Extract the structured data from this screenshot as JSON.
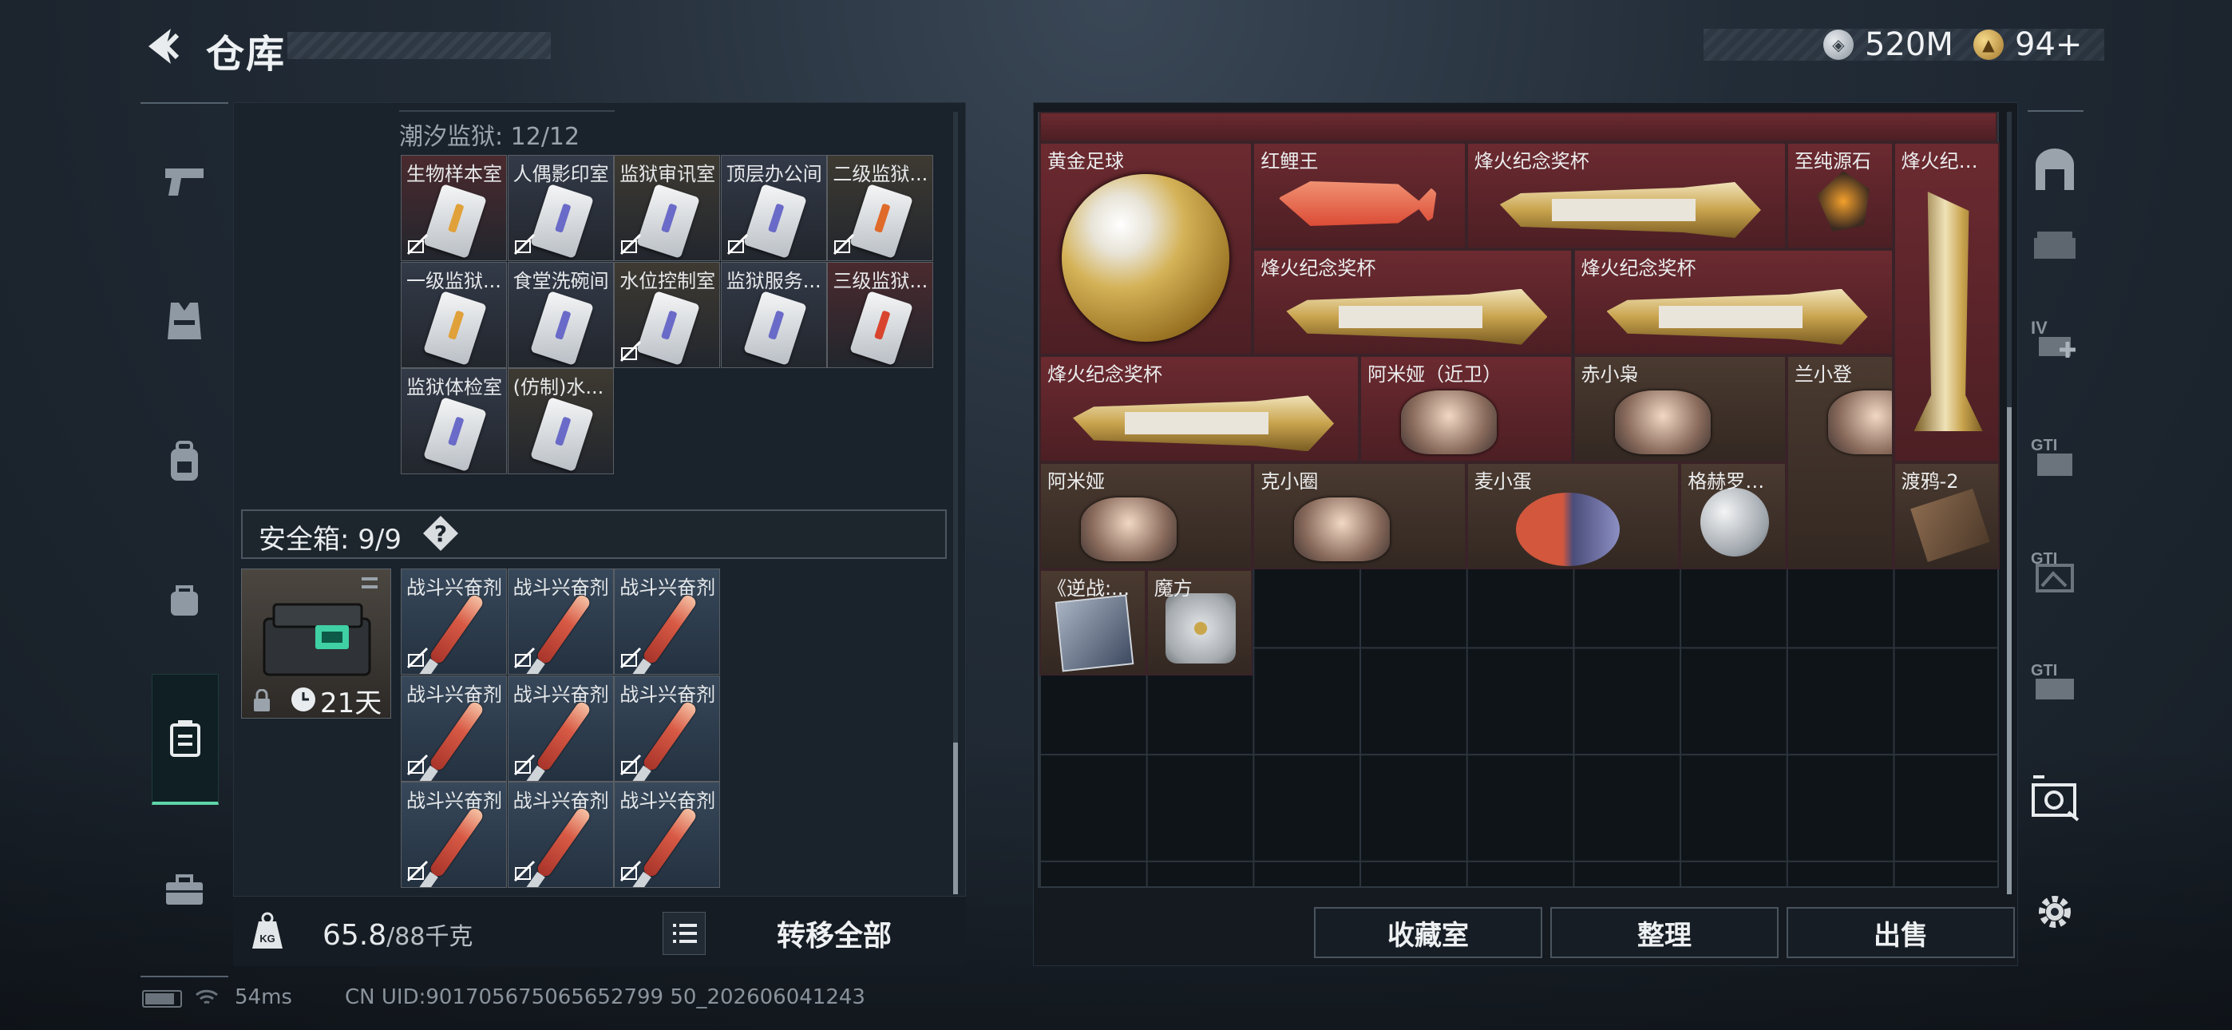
{
  "header": {
    "title": "仓库"
  },
  "currency": [
    {
      "icon": "silver-coin-icon",
      "value": "520M"
    },
    {
      "icon": "gold-coin-icon",
      "value": "94+"
    }
  ],
  "left_nav": [
    "pistol-icon",
    "vest-icon",
    "backpack-icon",
    "pouch-icon",
    "safe-case-icon",
    "briefcase-icon"
  ],
  "prison": {
    "label": "潮汐监狱: 12/12",
    "items": [
      "生物样本室",
      "人偶影印室",
      "监狱审讯室",
      "顶层办公间",
      "二级监狱...",
      "一级监狱...",
      "食堂洗碗间",
      "水位控制室",
      "监狱服务...",
      "三级监狱...",
      "监狱体检室",
      "(仿制)水..."
    ]
  },
  "safe": {
    "label": "安全箱: 9/9",
    "help": "?",
    "timer": "21天",
    "items": [
      "战斗兴奋剂",
      "战斗兴奋剂",
      "战斗兴奋剂",
      "战斗兴奋剂",
      "战斗兴奋剂",
      "战斗兴奋剂",
      "战斗兴奋剂",
      "战斗兴奋剂",
      "战斗兴奋剂"
    ]
  },
  "weight": {
    "current": "65.8",
    "max": "/88千克"
  },
  "transfer_label": "转移全部",
  "collection": {
    "items": [
      "黄金足球",
      "红鲤王",
      "烽火纪念奖杯",
      "至纯源石",
      "烽火纪念...",
      "烽火纪念奖杯",
      "烽火纪念奖杯",
      "烽火纪念奖杯",
      "阿米娅（近卫）",
      "赤小枭",
      "兰小登",
      "阿米娅",
      "克小圈",
      "麦小蛋",
      "格赫罗斯...",
      "渡鸦-2",
      "《逆战:...",
      "魔方"
    ]
  },
  "buttons": {
    "collection": "收藏室",
    "sort": "整理",
    "sell": "出售"
  },
  "status": {
    "ping": "54ms",
    "uid": "CN UID:901705675065652799 50_202606041243"
  },
  "colors": {
    "accent": "#5fd4a8",
    "rare_red": "#6b2a30"
  }
}
